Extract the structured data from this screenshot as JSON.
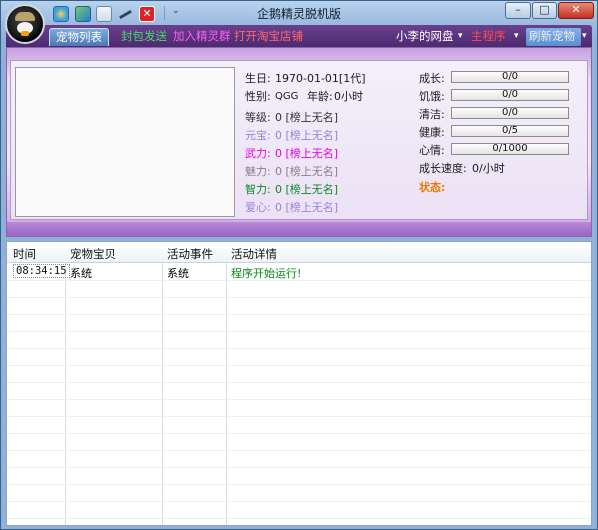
{
  "window": {
    "title": "企鹅精灵脱机版",
    "minimize_label": "–",
    "maximize_label": "□",
    "close_label": "✕",
    "quick_dropdown": "⌄",
    "close_tool_label": "✕"
  },
  "nav": {
    "tabs": [
      {
        "label": "宠物列表",
        "active": true
      },
      {
        "label": "封包发送"
      },
      {
        "label": "加入精灵群"
      },
      {
        "label": "打开淘宝店铺"
      }
    ],
    "right": [
      {
        "label": "小李的网盘",
        "arrow": "▾"
      },
      {
        "label": "主程序",
        "arrow": "▾"
      },
      {
        "label": "刷新宠物",
        "arrow": "▾"
      }
    ]
  },
  "pet": {
    "birthday_label": "生日:",
    "birthday_value": "1970-01-01[1代]",
    "gender_label": "性别:",
    "gender_value": "QGG",
    "age_label": "年龄:",
    "age_value": "0小时",
    "level_label": "等级:",
    "level_value": "0 [榜上无名]",
    "yuanbao_label": "元宝:",
    "yuanbao_value": "0 [榜上无名]",
    "wuli_label": "武力:",
    "wuli_value": "0 [榜上无名]",
    "meili_label": "魅力:",
    "meili_value": "0 [榜上无名]",
    "zhili_label": "智力:",
    "zhili_value": "0 [榜上无名]",
    "aixin_label": "爱心:",
    "aixin_value": "0 [榜上无名]"
  },
  "stats": {
    "growth_label": "成长:",
    "growth_value": "0/0",
    "growth_fraction": 0,
    "hunger_label": "饥饿:",
    "hunger_value": "0/0",
    "hunger_fraction": 0,
    "clean_label": "清洁:",
    "clean_value": "0/0",
    "clean_fraction": 0,
    "health_label": "健康:",
    "health_value": "0/5",
    "health_fraction": 0,
    "mood_label": "心情:",
    "mood_value": "0/1000",
    "mood_fraction": 0,
    "speed_label": "成长速度:",
    "speed_value": "0/小时",
    "status_label": "状态:"
  },
  "log": {
    "columns": [
      "时间",
      "宠物宝贝",
      "活动事件",
      "活动详情"
    ],
    "rows": [
      {
        "time": "08:34:15",
        "pet": "系统",
        "event": "系统",
        "detail": "程序开始运行!"
      }
    ]
  },
  "colors": {
    "nav_bg": "#5a3480",
    "wuli": "#e800e8",
    "zhili": "#0d8a25",
    "status": "#e87a00",
    "detail": "#0a8a18"
  }
}
